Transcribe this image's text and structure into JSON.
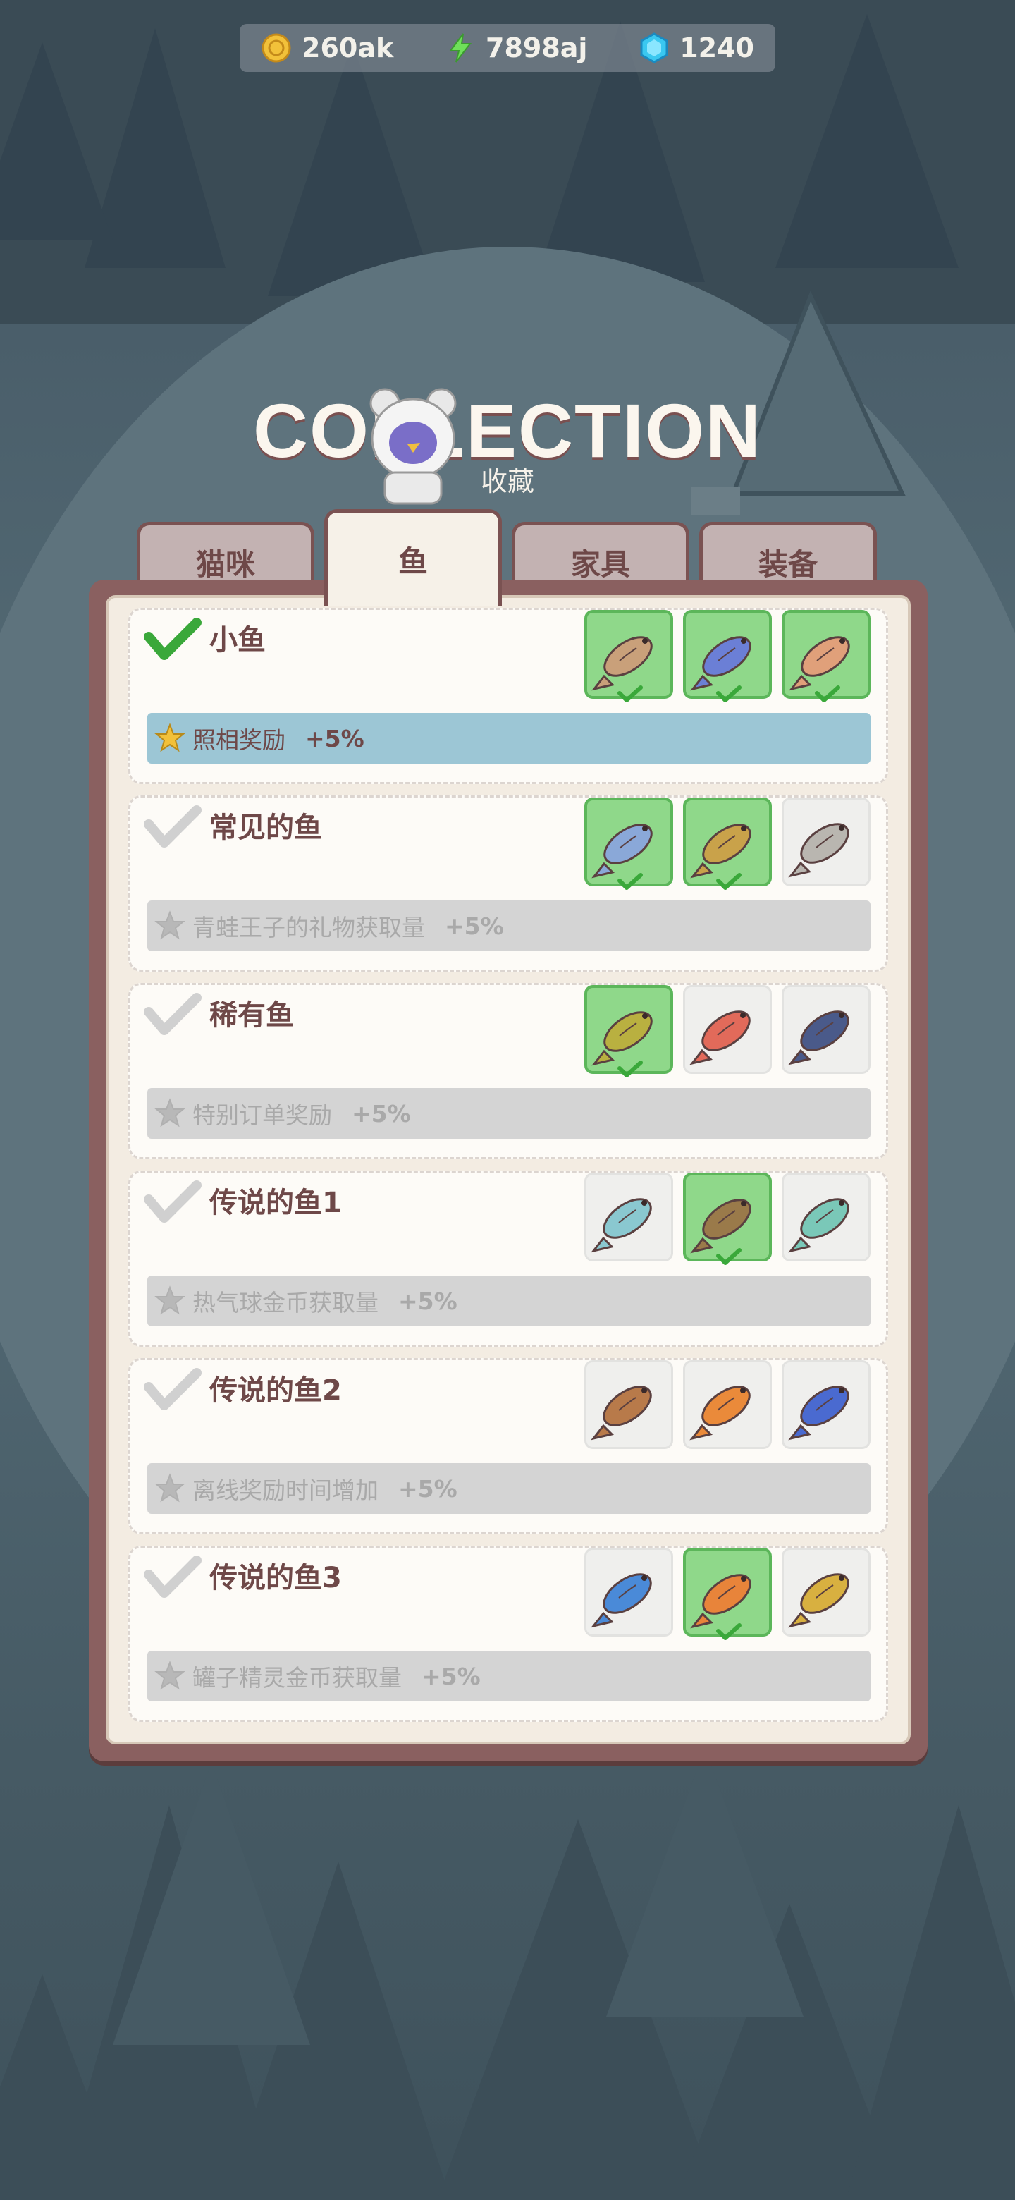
{
  "currency": {
    "coins": "260ak",
    "energy": "7898aj",
    "gems": "1240"
  },
  "header": {
    "title": "COLLECTION",
    "subtitle": "收藏"
  },
  "tabs": [
    {
      "label": "猫咪",
      "active": false
    },
    {
      "label": "鱼",
      "active": true
    },
    {
      "label": "家具",
      "active": false
    },
    {
      "label": "装备",
      "active": false
    }
  ],
  "rows": [
    {
      "name": "小鱼",
      "complete": true,
      "bonus": "照相奖励",
      "pct": "+5%",
      "fish": [
        {
          "collected": true,
          "color": "#c9a07a",
          "icon": "pike-fish-icon"
        },
        {
          "collected": true,
          "color": "#6b7fd6",
          "icon": "tuna-fish-icon"
        },
        {
          "collected": true,
          "color": "#e0a07a",
          "icon": "minnow-fish-icon"
        }
      ]
    },
    {
      "name": "常见的鱼",
      "complete": false,
      "bonus": "青蛙王子的礼物获取量",
      "pct": "+5%",
      "fish": [
        {
          "collected": true,
          "color": "#8aa8d8",
          "icon": "bluegill-fish-icon"
        },
        {
          "collected": true,
          "color": "#c9a24a",
          "icon": "carp-fish-icon"
        },
        {
          "collected": false,
          "color": "#b9b6b0",
          "icon": "sardine-fish-icon"
        }
      ]
    },
    {
      "name": "稀有鱼",
      "complete": false,
      "bonus": "特别订单奖励",
      "pct": "+5%",
      "fish": [
        {
          "collected": true,
          "color": "#b9b040",
          "icon": "flounder-fish-icon"
        },
        {
          "collected": false,
          "color": "#e26a5a",
          "icon": "snapper-fish-icon"
        },
        {
          "collected": false,
          "color": "#4a5a8a",
          "icon": "grouper-fish-icon"
        }
      ]
    },
    {
      "name": "传说的鱼1",
      "complete": false,
      "bonus": "热气球金币获取量",
      "pct": "+5%",
      "fish": [
        {
          "collected": false,
          "color": "#8ac8d0",
          "icon": "mackerel-fish-icon"
        },
        {
          "collected": true,
          "color": "#9a7a4a",
          "icon": "halibut-fish-icon"
        },
        {
          "collected": false,
          "color": "#7ac8b8",
          "icon": "parrot-fish-icon"
        }
      ]
    },
    {
      "name": "传说的鱼2",
      "complete": false,
      "bonus": "离线奖励时间增加",
      "pct": "+5%",
      "fish": [
        {
          "collected": false,
          "color": "#b87a4a",
          "icon": "rockfish-icon"
        },
        {
          "collected": false,
          "color": "#ea8a3a",
          "icon": "clownfish-icon"
        },
        {
          "collected": false,
          "color": "#4a6ad0",
          "icon": "tang-fish-icon"
        }
      ]
    },
    {
      "name": "传说的鱼3",
      "complete": false,
      "bonus": "罐子精灵金币获取量",
      "pct": "+5%",
      "fish": [
        {
          "collected": false,
          "color": "#4a8ad8",
          "icon": "yellowfin-tuna-icon"
        },
        {
          "collected": true,
          "color": "#e8843a",
          "icon": "perch-fish-icon"
        },
        {
          "collected": false,
          "color": "#d8b040",
          "icon": "golden-fish-icon"
        }
      ]
    }
  ],
  "colors": {
    "collected_slot": "#8fd88a",
    "complete_bonus": "#9cc6d5",
    "panel_border": "#8a6060",
    "text_brown": "#6e4848"
  }
}
